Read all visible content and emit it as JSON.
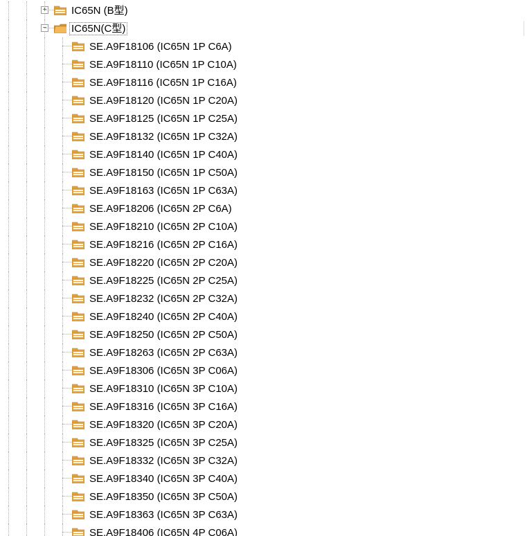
{
  "tree": {
    "indent_levels": 3,
    "parent_nodes": [
      {
        "id": "b-type",
        "label": "IC65N (B型)",
        "expanded": false,
        "selected": false
      },
      {
        "id": "c-type",
        "label": "IC65N(C型)",
        "expanded": true,
        "selected": true
      }
    ],
    "children": [
      {
        "label": "SE.A9F18106 (IC65N 1P C6A)"
      },
      {
        "label": "SE.A9F18110 (IC65N 1P C10A)"
      },
      {
        "label": "SE.A9F18116 (IC65N 1P C16A)"
      },
      {
        "label": "SE.A9F18120 (IC65N 1P C20A)"
      },
      {
        "label": "SE.A9F18125 (IC65N 1P C25A)"
      },
      {
        "label": "SE.A9F18132 (IC65N 1P C32A)"
      },
      {
        "label": "SE.A9F18140 (IC65N 1P C40A)"
      },
      {
        "label": "SE.A9F18150 (IC65N 1P C50A)"
      },
      {
        "label": "SE.A9F18163 (IC65N 1P C63A)"
      },
      {
        "label": "SE.A9F18206 (IC65N 2P C6A)"
      },
      {
        "label": "SE.A9F18210 (IC65N 2P C10A)"
      },
      {
        "label": "SE.A9F18216 (IC65N 2P C16A)"
      },
      {
        "label": "SE.A9F18220 (IC65N 2P C20A)"
      },
      {
        "label": "SE.A9F18225 (IC65N 2P C25A)"
      },
      {
        "label": "SE.A9F18232 (IC65N 2P C32A)"
      },
      {
        "label": "SE.A9F18240 (IC65N 2P C40A)"
      },
      {
        "label": "SE.A9F18250 (IC65N 2P C50A)"
      },
      {
        "label": "SE.A9F18263 (IC65N 2P C63A)"
      },
      {
        "label": "SE.A9F18306 (IC65N 3P C06A)"
      },
      {
        "label": "SE.A9F18310 (IC65N 3P C10A)"
      },
      {
        "label": "SE.A9F18316 (IC65N 3P C16A)"
      },
      {
        "label": "SE.A9F18320 (IC65N 3P C20A)"
      },
      {
        "label": "SE.A9F18325 (IC65N 3P C25A)"
      },
      {
        "label": "SE.A9F18332 (IC65N 3P C32A)"
      },
      {
        "label": "SE.A9F18340 (IC65N 3P C40A)"
      },
      {
        "label": "SE.A9F18350 (IC65N 3P C50A)"
      },
      {
        "label": "SE.A9F18363 (IC65N 3P C63A)"
      },
      {
        "label": "SE.A9F18406 (IC65N 4P C06A)"
      }
    ],
    "expander_plus": "+",
    "expander_minus": "−"
  }
}
